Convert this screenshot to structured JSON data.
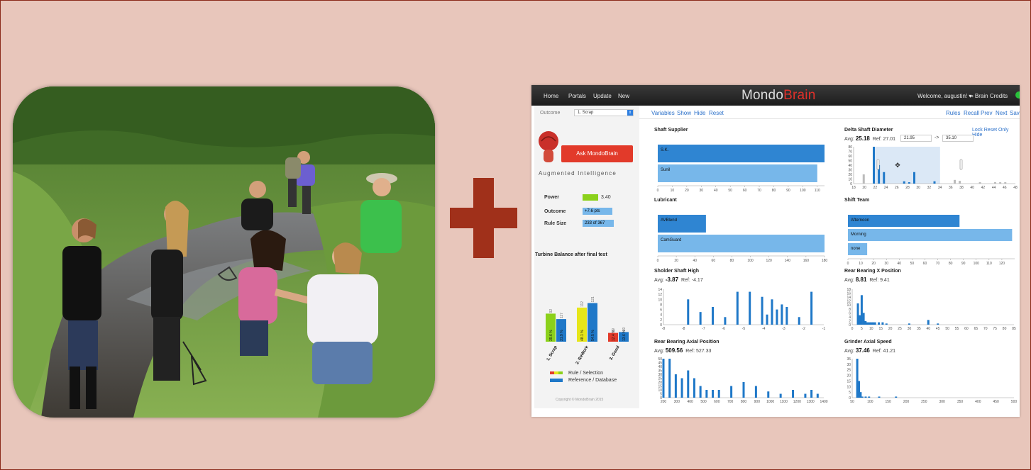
{
  "colors": {
    "background": "#e8c6bb",
    "plus": "#a0301a",
    "primary_bar": "#2f85d2",
    "reference_bar": "#77b7ea",
    "power": "#8bd11b"
  },
  "screenshot": {
    "nav": [
      "Home",
      "Portals",
      "Update",
      "New"
    ],
    "logo": {
      "part1": "Mondo",
      "part2": "Brain"
    },
    "welcome": "Welcome, augustin! ▾",
    "credits": "∞ Brain Credits",
    "sidebar": {
      "outcome_label": "Outcome",
      "outcome_value": "1. Scrap",
      "ask_button": "Ask   MondoBrain",
      "tagline": "Augmented  Intelligence",
      "stats": [
        {
          "label": "Power",
          "value": "3.40"
        },
        {
          "label": "Outcome",
          "value": "+7.6 pts"
        },
        {
          "label": "Rule Size",
          "value": "233 of 367"
        }
      ],
      "chart_title": "Turbine Balance after final test",
      "legend": [
        "Rule / Selection",
        "Reference / Database"
      ],
      "copyright": "Copyright © MondoBrain 2015"
    },
    "toolbar_left": [
      "Variables",
      "Show",
      "Hide",
      "Reset"
    ],
    "toolbar_right": [
      "Rules",
      "Recall",
      "Prev",
      "Next",
      "Save"
    ],
    "panels": {
      "shaft_supplier": "Shaft Supplier",
      "delta": {
        "title": "Delta Shaft Diameter",
        "avg_label": "Avg:",
        "avg": "25.18",
        "ref": "Ref: 27.01",
        "low": "21.95",
        "high": "35.10",
        "arrow": "->",
        "actions": "Lock  Reset  Only  Hide"
      },
      "lubricant": "Lubricant",
      "shift_team": "Shift Team",
      "sholder": {
        "title": "Sholder Shaft High",
        "avg_label": "Avg:",
        "avg": "-3.87",
        "ref": "Ref: -4.17"
      },
      "rear_x": {
        "title": "Rear Bearing X Position",
        "avg_label": "Avg:",
        "avg": "8.81",
        "ref": "Ref: 9.41"
      },
      "rear_axial": {
        "title": "Rear Bearing Axial Position",
        "avg_label": "Avg:",
        "avg": "509.56",
        "ref": "Ref: 527.33"
      },
      "grinder": {
        "title": "Grinder Axial Speed",
        "avg_label": "Avg:",
        "avg": "37.46",
        "ref": "Ref: 41.21"
      }
    }
  },
  "chart_data": [
    {
      "type": "bar",
      "title": "Shaft Supplier",
      "orientation": "horizontal",
      "categories": [
        "S.K.",
        "Sunil"
      ],
      "series": [
        {
          "values": [
            115,
            110
          ]
        }
      ],
      "xlim": [
        0,
        115
      ],
      "ticks": [
        "0",
        "10",
        "20",
        "30",
        "40",
        "50",
        "60",
        "70",
        "80",
        "90",
        "100",
        "110"
      ]
    },
    {
      "type": "bar",
      "title": "Lubricant",
      "orientation": "horizontal",
      "categories": [
        "AVBlend",
        "CamGuard"
      ],
      "series": [
        {
          "values": [
            52,
            180
          ]
        }
      ],
      "xlim": [
        0,
        180
      ],
      "ticks": [
        "0",
        "20",
        "40",
        "60",
        "80",
        "100",
        "120",
        "140",
        "160",
        "180"
      ]
    },
    {
      "type": "bar",
      "title": "Shift Team",
      "orientation": "horizontal",
      "categories": [
        "Afternoon",
        "Morning",
        "none"
      ],
      "series": [
        {
          "values": [
            87,
            128,
            15
          ]
        }
      ],
      "xlim": [
        0,
        130
      ],
      "ticks": [
        "0",
        "10",
        "20",
        "30",
        "40",
        "50",
        "60",
        "70",
        "80",
        "90",
        "100",
        "110",
        "120"
      ]
    },
    {
      "type": "bar",
      "title": "Turbine Balance after final test",
      "categories": [
        "1. Scrap",
        "2. ReWork",
        "3. Good"
      ],
      "series": [
        {
          "name": "Rule / Selection",
          "values": [
            39.6,
            48.1,
            12.4
          ]
        },
        {
          "name": "Reference / Database",
          "values": [
            31.9,
            54.5,
            13.6
          ]
        }
      ],
      "labels": {
        "rule": [
          "39.6 %",
          "48.1 %",
          "12.4 %"
        ],
        "ref": [
          "31.9 %",
          "54.5 %",
          "13.6 %"
        ],
        "top_rule": [
          "92",
          "112",
          "29"
        ],
        "top_ref": [
          "117",
          "121",
          "49"
        ]
      },
      "ylim": [
        0,
        60
      ]
    },
    {
      "type": "bar",
      "title": "Delta Shaft Diameter",
      "x": [
        18,
        19,
        20,
        21,
        22,
        23,
        24,
        25,
        26,
        27,
        28,
        29,
        30,
        31,
        32,
        33,
        34,
        35,
        36,
        37,
        38,
        39,
        40,
        41,
        42,
        43,
        44,
        45,
        46,
        47,
        48,
        49,
        50
      ],
      "values": [
        0,
        0,
        20,
        0,
        80,
        40,
        25,
        0,
        0,
        0,
        5,
        3,
        25,
        0,
        0,
        0,
        5,
        0,
        0,
        0,
        8,
        6,
        0,
        0,
        0,
        3,
        0,
        0,
        3,
        3,
        3,
        0,
        0
      ],
      "ylim": [
        0,
        80
      ],
      "xticks": [
        "18",
        "20",
        "22",
        "24",
        "26",
        "28",
        "30",
        "32",
        "34",
        "36",
        "38",
        "40",
        "42",
        "44",
        "46",
        "48"
      ],
      "yticks": [
        "0",
        "10",
        "20",
        "30",
        "40",
        "50",
        "60",
        "70",
        "80"
      ]
    },
    {
      "type": "bar",
      "title": "Sholder Shaft High",
      "x": [
        -7,
        -6.5,
        -6,
        -5.5,
        -5,
        -4.5,
        -4,
        -3.8,
        -3.6,
        -3.4,
        -3.2,
        -3,
        -2.5,
        -2
      ],
      "values": [
        10,
        5,
        7,
        3,
        13,
        13,
        11,
        4,
        10,
        6,
        8,
        7,
        3,
        13
      ],
      "ylim": [
        0,
        14
      ],
      "xticks": [
        "-8",
        "-8",
        "-7",
        "-6",
        "-5",
        "-4",
        "-3",
        "-2",
        "-1"
      ],
      "yticks": [
        "0",
        "2",
        "4",
        "6",
        "8",
        "10",
        "12",
        "14"
      ]
    },
    {
      "type": "bar",
      "title": "Rear Bearing X Position",
      "x": [
        3,
        4,
        5,
        6,
        7,
        8,
        9,
        10,
        11,
        12,
        14,
        16,
        18,
        30,
        40,
        45
      ],
      "values": [
        18,
        8,
        25,
        10,
        3,
        2,
        2,
        2,
        2,
        2,
        2,
        2,
        1,
        1,
        4,
        1
      ],
      "ylim": [
        0,
        30
      ],
      "xticks": [
        "0",
        "5",
        "10",
        "15",
        "20",
        "25",
        "30",
        "35",
        "40",
        "45",
        "50",
        "55",
        "60",
        "65",
        "70",
        "75",
        "80",
        "85"
      ],
      "yticks": [
        "0",
        "2",
        "4",
        "6",
        "8",
        "10",
        "12",
        "14",
        "16",
        "18"
      ]
    },
    {
      "type": "bar",
      "title": "Rear Bearing Axial Position",
      "x": [
        150,
        200,
        250,
        300,
        350,
        400,
        450,
        500,
        550,
        600,
        700,
        800,
        900,
        1000,
        1100,
        1200,
        1300,
        1350,
        1400
      ],
      "values": [
        50,
        50,
        30,
        25,
        35,
        25,
        15,
        10,
        10,
        10,
        15,
        20,
        15,
        8,
        5,
        10,
        5,
        10,
        5
      ],
      "ylim": [
        0,
        50
      ],
      "xticks": [
        "200",
        "300",
        "400",
        "500",
        "600",
        "700",
        "800",
        "900",
        "1000",
        "1100",
        "1200",
        "1300",
        "1400"
      ],
      "yticks": [
        "0",
        "5",
        "10",
        "15",
        "20",
        "25",
        "30",
        "35",
        "40",
        "45",
        "50"
      ]
    },
    {
      "type": "bar",
      "title": "Grinder Axial Speed",
      "x": [
        35,
        40,
        45,
        50,
        60,
        70,
        100,
        150
      ],
      "values": [
        35,
        15,
        5,
        1,
        1,
        1,
        1,
        1
      ],
      "ylim": [
        0,
        35
      ],
      "xticks": [
        "50",
        "100",
        "150",
        "200",
        "250",
        "300",
        "350",
        "400",
        "450",
        "500"
      ],
      "yticks": [
        "0",
        "5",
        "10",
        "15",
        "20",
        "25",
        "30",
        "35"
      ]
    }
  ]
}
